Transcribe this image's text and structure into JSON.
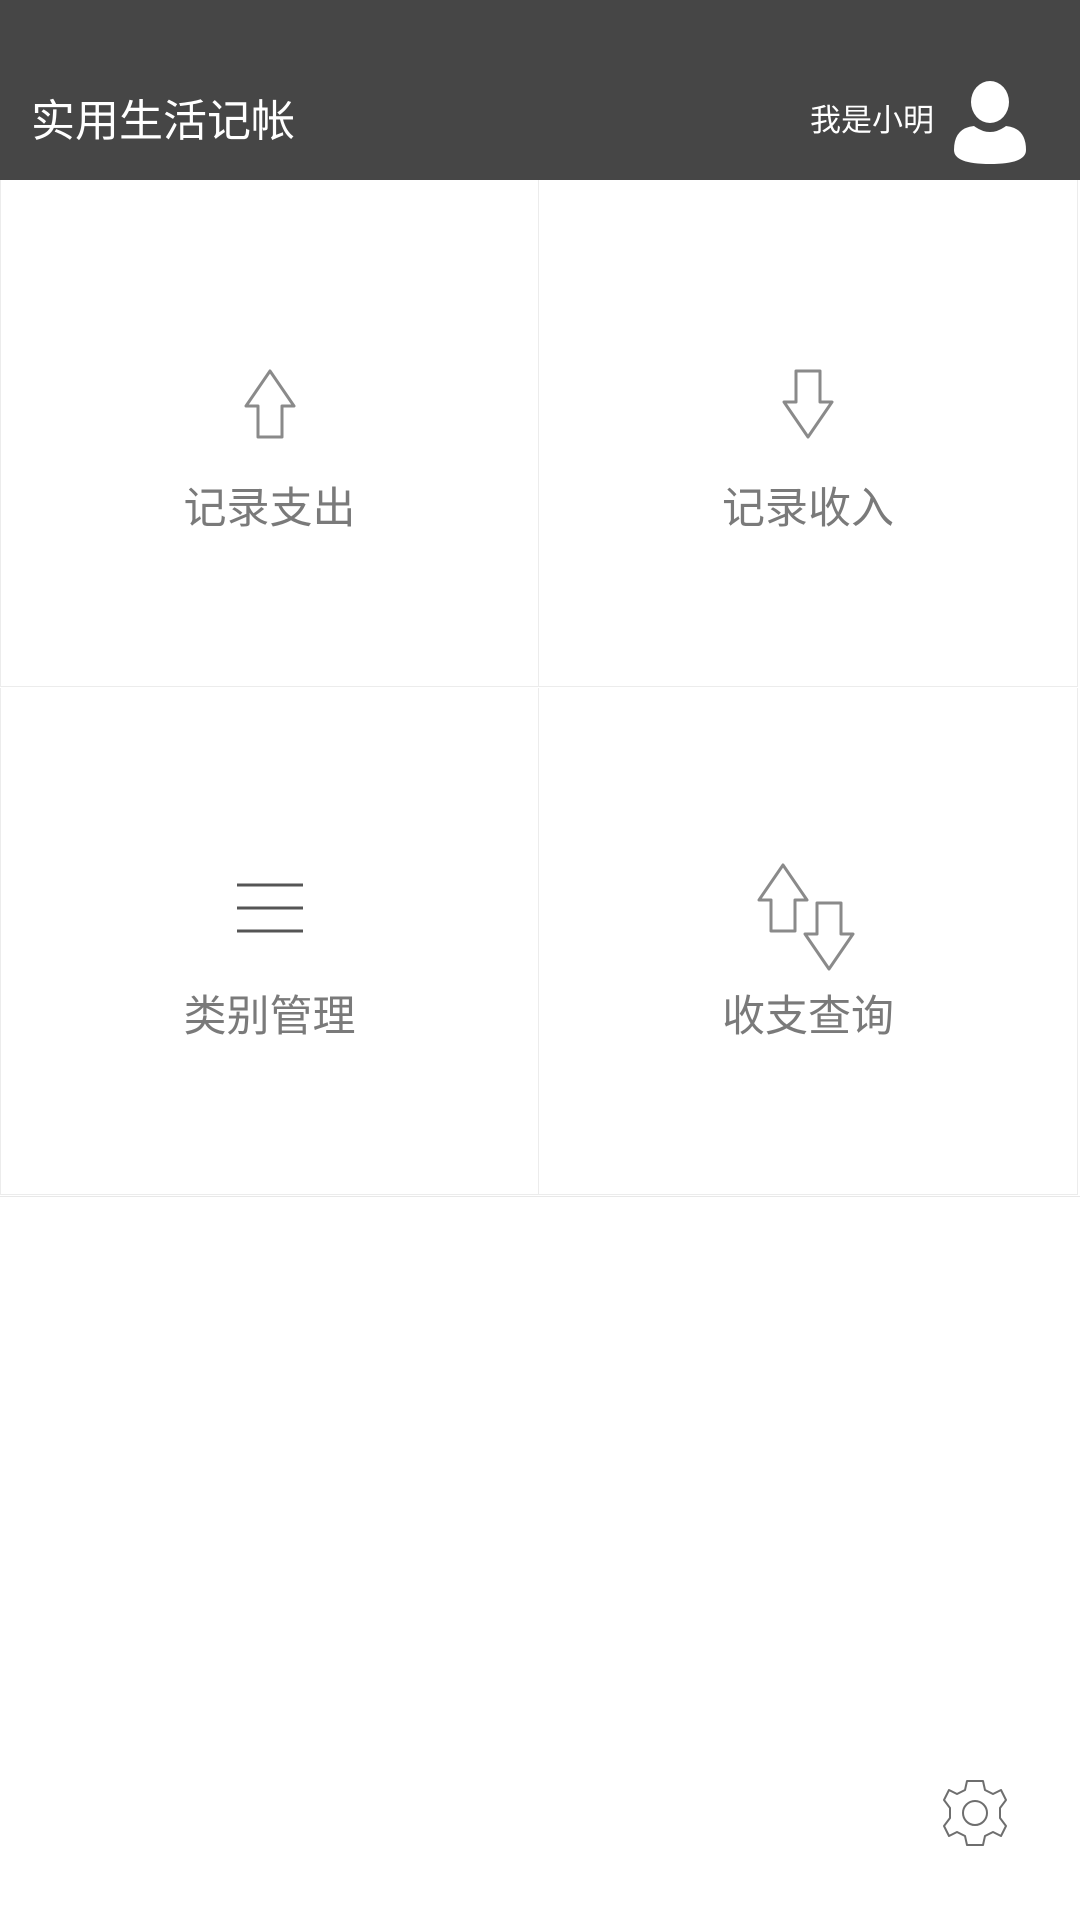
{
  "header": {
    "title": "实用生活记帐",
    "user_name": "我是小明",
    "avatar_icon": "user-avatar-icon",
    "background_color": "#464646"
  },
  "menu": {
    "items": [
      {
        "label": "记录支出",
        "icon": "arrow-up-icon"
      },
      {
        "label": "记录收入",
        "icon": "arrow-down-icon"
      },
      {
        "label": "类别管理",
        "icon": "list-icon"
      },
      {
        "label": "收支查询",
        "icon": "up-down-arrows-icon"
      }
    ]
  },
  "footer": {
    "settings_icon": "gear-icon"
  }
}
